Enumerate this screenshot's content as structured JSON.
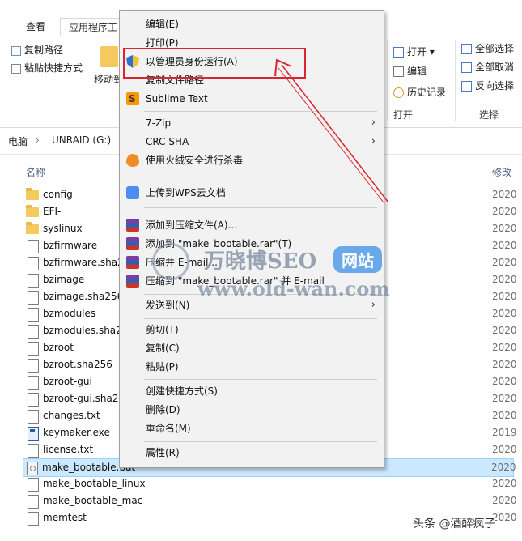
{
  "ribbon": {
    "tabs": [
      "查看",
      "应用程序工"
    ],
    "copy_path": "复制路径",
    "paste_shortcut": "粘贴快捷方式",
    "move_to": "移动到",
    "open": "打开",
    "edit": "编辑",
    "history": "历史记录",
    "open_group": "打开",
    "select_all": "全部选择",
    "select_none": "全部取消",
    "invert_selection": "反向选择",
    "select_group": "选择"
  },
  "address": {
    "pc": "电脑",
    "drive": "UNRAID (G:)"
  },
  "columns": {
    "name": "名称",
    "modified": "修改"
  },
  "files": [
    {
      "name": "config",
      "type": "folder",
      "date": "2020"
    },
    {
      "name": "EFI-",
      "type": "folder",
      "date": "2020"
    },
    {
      "name": "syslinux",
      "type": "folder",
      "date": "2020"
    },
    {
      "name": "bzfirmware",
      "type": "doc",
      "date": "2020"
    },
    {
      "name": "bzfirmware.sha2",
      "type": "doc",
      "date": "2020"
    },
    {
      "name": "bzimage",
      "type": "doc",
      "date": "2020"
    },
    {
      "name": "bzimage.sha256",
      "type": "doc",
      "date": "2020"
    },
    {
      "name": "bzmodules",
      "type": "doc",
      "date": "2020"
    },
    {
      "name": "bzmodules.sha2",
      "type": "doc",
      "date": "2020"
    },
    {
      "name": "bzroot",
      "type": "doc",
      "date": "2020"
    },
    {
      "name": "bzroot.sha256",
      "type": "doc",
      "date": "2020"
    },
    {
      "name": "bzroot-gui",
      "type": "doc",
      "date": "2020"
    },
    {
      "name": "bzroot-gui.sha2",
      "type": "doc",
      "date": "2020"
    },
    {
      "name": "changes.txt",
      "type": "doc",
      "date": "2020"
    },
    {
      "name": "keymaker.exe",
      "type": "exe",
      "date": "2019"
    },
    {
      "name": "license.txt",
      "type": "doc",
      "date": "2020"
    },
    {
      "name": "make_bootable.bat",
      "type": "bat",
      "date": "2020",
      "selected": true
    },
    {
      "name": "make_bootable_linux",
      "type": "doc",
      "date": "2020"
    },
    {
      "name": "make_bootable_mac",
      "type": "doc",
      "date": "2020"
    },
    {
      "name": "memtest",
      "type": "doc",
      "date": "2020"
    }
  ],
  "menu": {
    "edit": "编辑(E)",
    "print": "打印(P)",
    "run_as_admin": "以管理员身份运行(A)",
    "copy_path": "复制文件路径",
    "sublime": "Sublime Text",
    "sevenzip": "7-Zip",
    "crcsha": "CRC SHA",
    "antivirus": "使用火绒安全进行杀毒",
    "wps_upload": "上传到WPS云文档",
    "add_archive": "添加到压缩文件(A)...",
    "add_rar": "添加到 \"make_bootable.rar\"(T)",
    "compress_email": "压缩并 E-mail...",
    "compress_rar_email": "压缩到 \"make_bootable.rar\" 并 E-mail",
    "send_to": "发送到(N)",
    "cut": "剪切(T)",
    "copy": "复制(C)",
    "paste": "粘贴(P)",
    "create_shortcut": "创建快捷方式(S)",
    "delete": "删除(D)",
    "rename": "重命名(M)",
    "properties": "属性(R)"
  },
  "watermark": {
    "brand": "万晓博SEO",
    "badge": "网站",
    "url": "www.old-wan.com"
  },
  "credit": "头条 @酒醉疯子",
  "colors": {
    "highlight_box": "#d9262e",
    "selected_row": "#cce8ff"
  }
}
